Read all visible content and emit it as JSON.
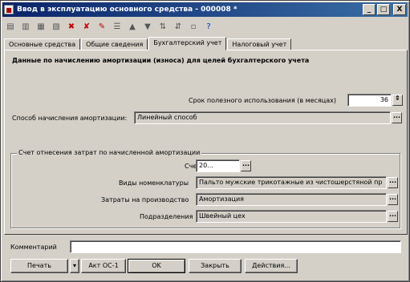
{
  "window": {
    "title": "Ввод в эксплуатацию основного средства - 000008 *",
    "minimize": "_",
    "maximize": "□",
    "close": "X"
  },
  "toolbar": {
    "icons": [
      "copy-icon",
      "doc-icon",
      "doc-icon",
      "doc-icon",
      "delete-icon",
      "delete-icon",
      "edit-icon",
      "list-icon",
      "arrow-up-icon",
      "arrow-down-icon",
      "sort-icon",
      "sort-icon",
      "doc-icon",
      "help-icon"
    ]
  },
  "tabs": [
    {
      "label": "Основные средства",
      "active": false
    },
    {
      "label": "Общие сведения",
      "active": false
    },
    {
      "label": "Бухгалтерский учет",
      "active": true
    },
    {
      "label": "Налоговый учет",
      "active": false
    }
  ],
  "accounting": {
    "section_title": "Данные по начислению амортизации (износа) для целей бухгалтерского учета",
    "useful_life_label": "Срок полезного использования (в месяцах)",
    "useful_life_value": "36",
    "method_label": "Способ начисления амортизации:",
    "method_value": "Линейный способ"
  },
  "expense_group": {
    "title": "Счет отнесения затрат по начисленной амортизации",
    "account_label": "Счет",
    "account_value": "20...",
    "nomenclature_label": "Виды номенклатуры",
    "nomenclature_value": "Пальто мужские трикотажные из чистошерстяной пр",
    "costs_label": "Затраты на производство",
    "costs_value": "Амортизация",
    "division_label": "Подразделения",
    "division_value": "Швейный цех"
  },
  "comment": {
    "label": "Комментарий",
    "value": ""
  },
  "buttons": {
    "print": "Печать",
    "act": "Акт ОС-1",
    "ok": "OK",
    "close": "Закрыть",
    "actions": "Действия..."
  }
}
